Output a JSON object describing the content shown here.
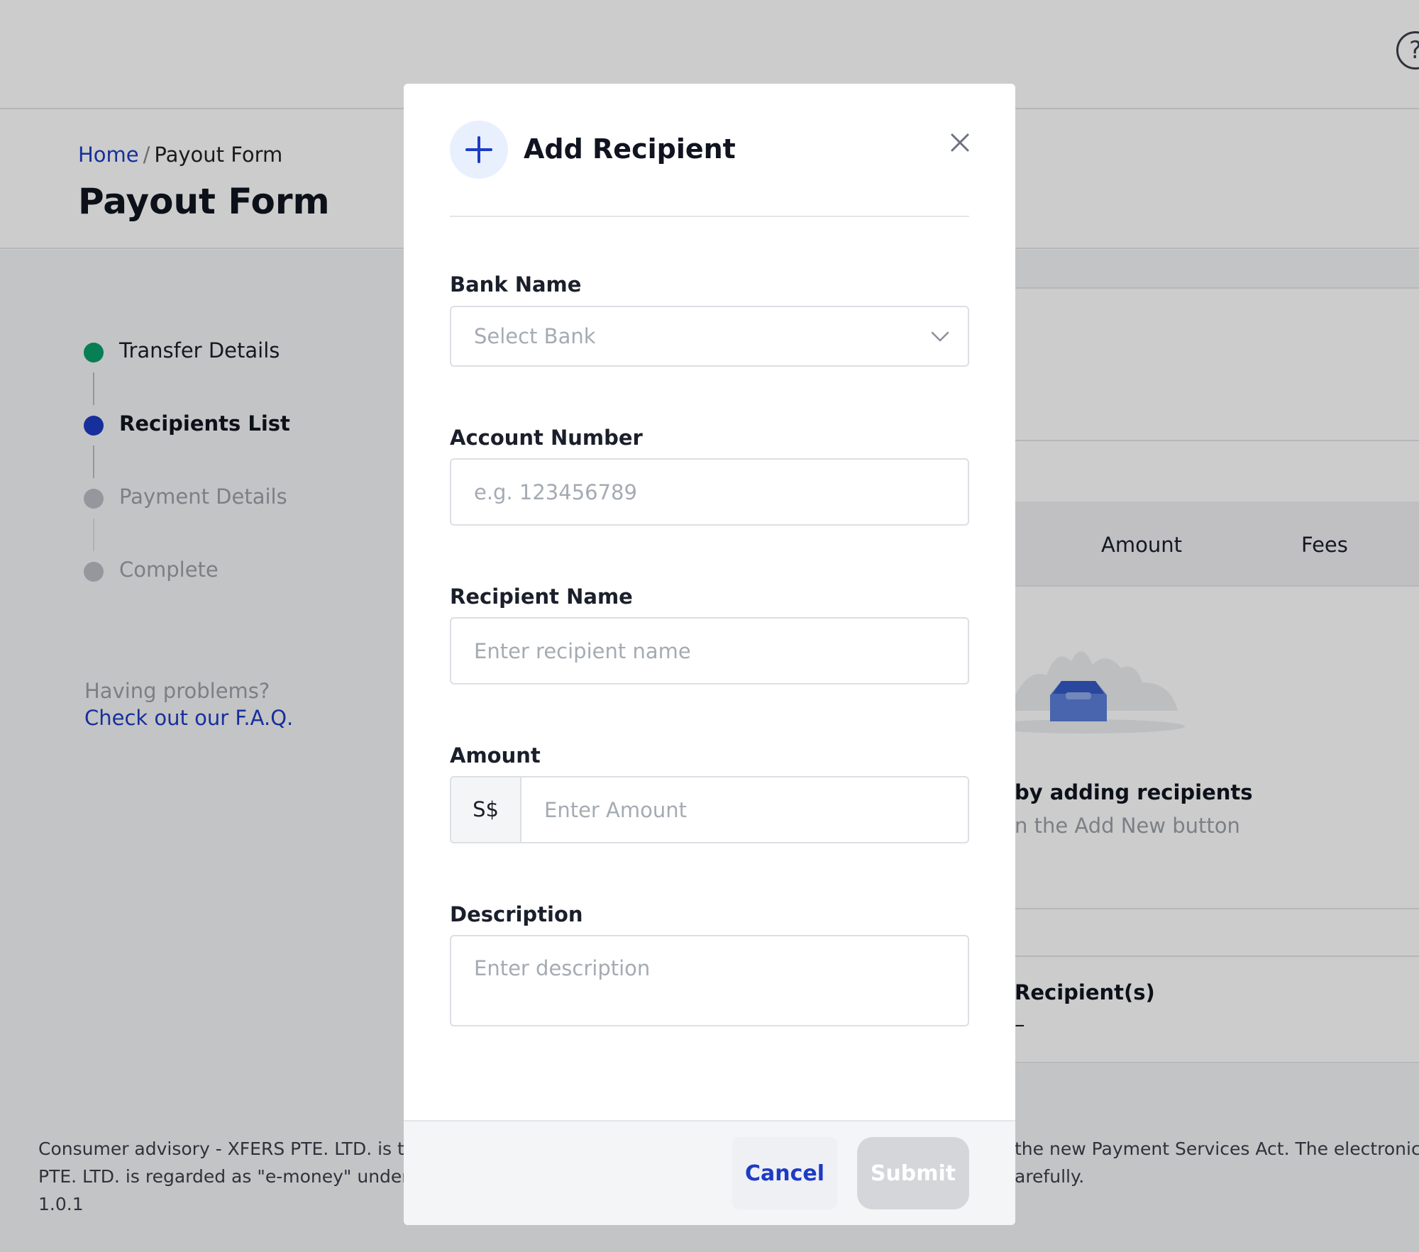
{
  "page": {
    "help_label": "?",
    "breadcrumb": {
      "home": "Home",
      "separator": "/",
      "current": "Payout Form"
    },
    "title": "Payout Form"
  },
  "stepper": {
    "steps": [
      {
        "label": "Transfer Details",
        "state": "done"
      },
      {
        "label": "Recipients List",
        "state": "active"
      },
      {
        "label": "Payment Details",
        "state": "todo"
      },
      {
        "label": "Complete",
        "state": "todo"
      }
    ]
  },
  "help": {
    "question": "Having problems?",
    "link": "Check out our F.A.Q."
  },
  "recipients_card": {
    "columns": [
      "Amount",
      "Fees"
    ],
    "empty_title": "by adding recipients",
    "empty_subtitle": "n the Add New button",
    "recipients_label": "Recipient(s)",
    "recipients_value": "–"
  },
  "footer": {
    "line1": "Consumer advisory - XFERS PTE. LTD. is the",
    "line1_right": "the new Payment Services Act. The electronically",
    "line2": "PTE. LTD. is regarded as \"e-money\" under Si",
    "line2_right": "arefully.",
    "version": "1.0.1"
  },
  "modal": {
    "title": "Add Recipient",
    "bank": {
      "label": "Bank Name",
      "placeholder": "Select Bank"
    },
    "account": {
      "label": "Account Number",
      "placeholder": "e.g. 123456789"
    },
    "recipient": {
      "label": "Recipient Name",
      "placeholder": "Enter recipient name"
    },
    "amount": {
      "label": "Amount",
      "currency": "S$",
      "placeholder": "Enter Amount"
    },
    "description": {
      "label": "Description",
      "placeholder": "Enter description"
    },
    "cancel_label": "Cancel",
    "submit_label": "Submit"
  },
  "colors": {
    "primary": "#1d3bc4",
    "success": "#0a9e6a",
    "muted": "#b9bdc4",
    "submit_disabled": "#d4d6d9"
  },
  "icons": [
    "help-icon",
    "plus-icon",
    "close-icon",
    "chevron-down-icon",
    "inbox-icon"
  ]
}
